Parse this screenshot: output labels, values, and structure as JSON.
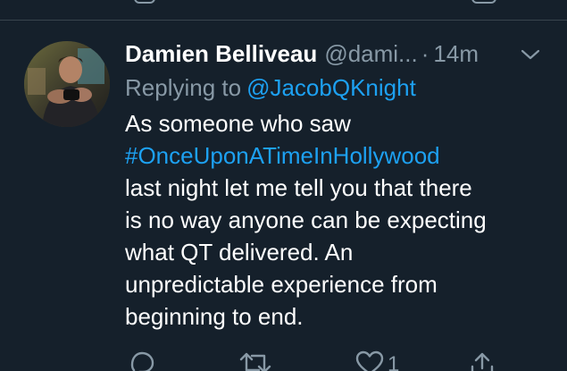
{
  "tweet": {
    "display_name": "Damien Belliveau",
    "handle": "@dami...",
    "separator": "·",
    "time": "14m",
    "replying_to_label": "Replying to",
    "replying_to_handle": "@JacobQKnight",
    "text_lines": [
      "As someone who saw",
      "#OnceUponATimeInHollywood",
      "last night let me tell you that there",
      "is no way anyone can be expecting",
      "what QT delivered. An",
      "unpredictable experience from",
      "beginning to end."
    ],
    "like_count": "1"
  },
  "icons": {
    "more": "chevron-down-icon",
    "reply": "reply-icon",
    "retweet": "retweet-icon",
    "like": "heart-icon",
    "share": "share-icon"
  },
  "colors": {
    "background": "#15202b",
    "primary_text": "#ffffff",
    "secondary_text": "#8899a6",
    "link": "#1da1f2",
    "divider": "#38444d"
  }
}
